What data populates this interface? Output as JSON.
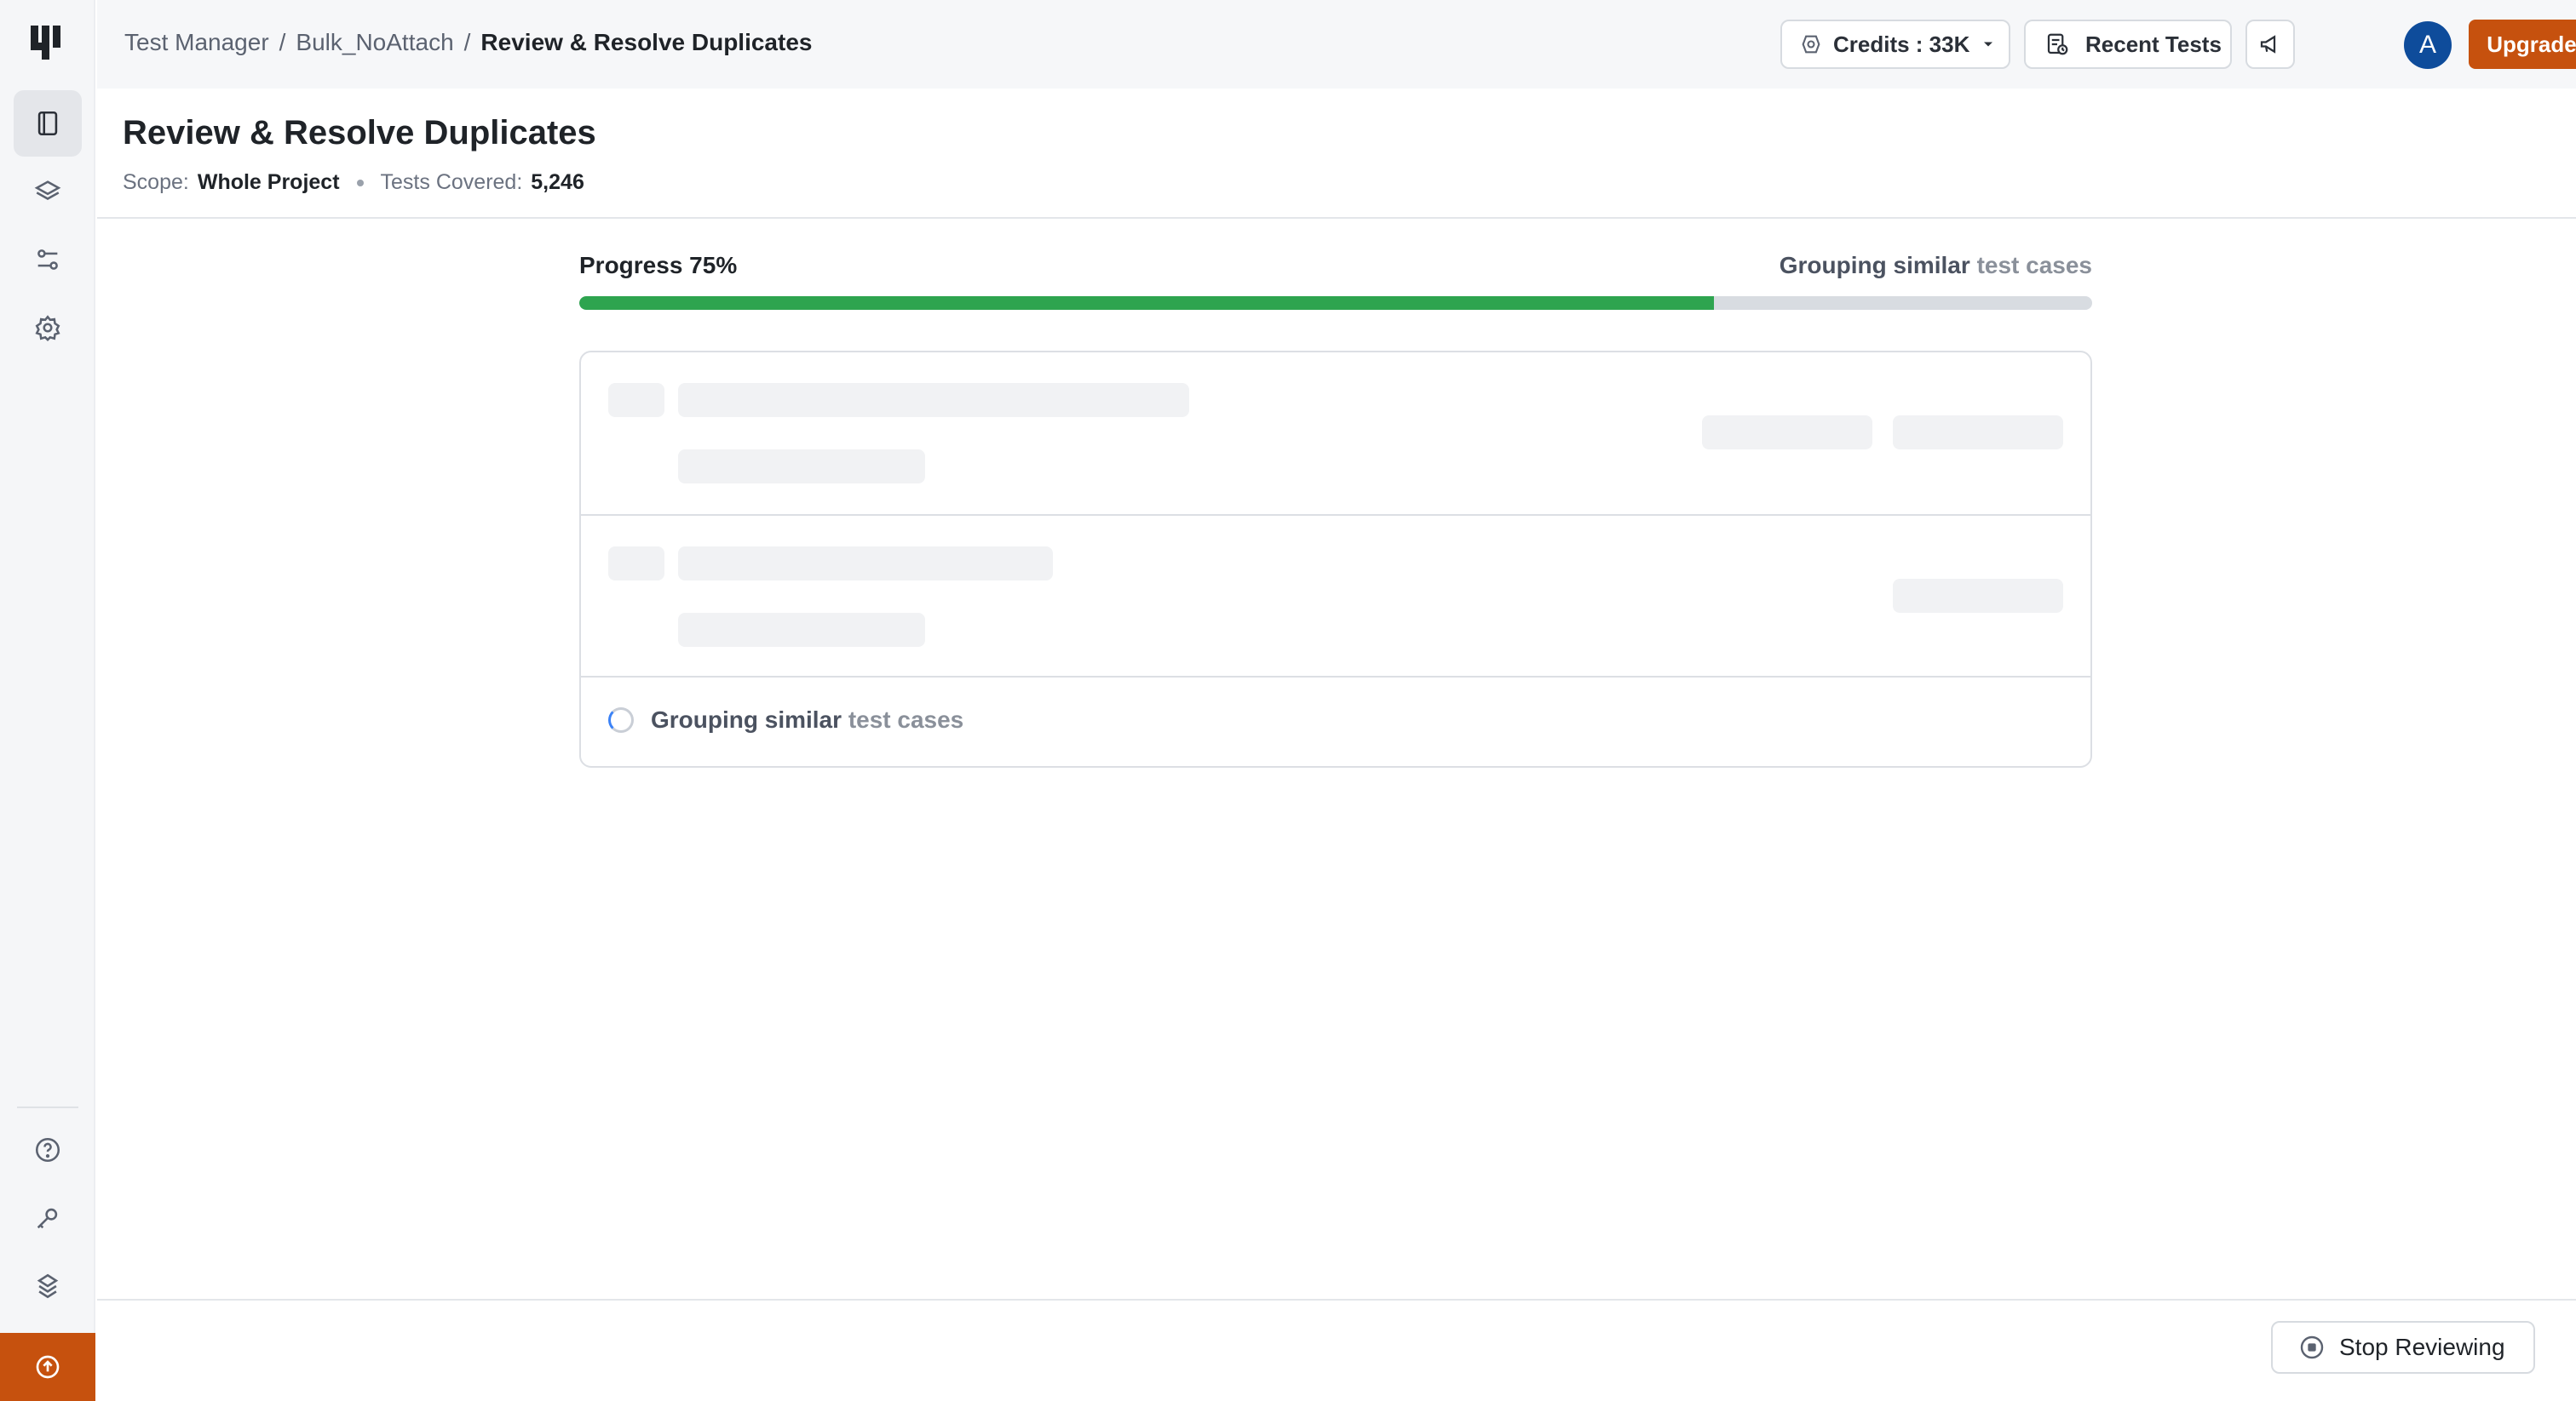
{
  "breadcrumb": {
    "root": "Test Manager",
    "sep": "/",
    "project": "Bulk_NoAttach",
    "current": "Review & Resolve Duplicates"
  },
  "topbar": {
    "credits_label": "Credits : 33K",
    "recent_label": "Recent Tests",
    "avatar_initial": "A",
    "upgrade_label": "Upgrade Now"
  },
  "page": {
    "title": "Review & Resolve Duplicates",
    "scope_label": "Scope:",
    "scope_value": "Whole Project",
    "tests_label": "Tests Covered:",
    "tests_value": "5,246"
  },
  "progress": {
    "label": "Progress 75%",
    "value": 0.75,
    "status_main": "Grouping similar",
    "status_dim": "test cases"
  },
  "loading": {
    "status_main": "Grouping similar",
    "status_dim": "test cases"
  },
  "footer": {
    "stop_label": "Stop Reviewing"
  },
  "colors": {
    "accent": "#c6510e",
    "progress": "#2ea44f",
    "avatar": "#0e4c9b"
  },
  "icons": [
    "logo",
    "tests-icon",
    "layers-icon",
    "filters-icon",
    "settings-icon",
    "help-icon",
    "key-icon",
    "integrations-icon",
    "upgrade-arrow-icon",
    "credits-icon",
    "chevron-down-icon",
    "recent-tests-icon",
    "megaphone-icon",
    "stop-icon"
  ]
}
